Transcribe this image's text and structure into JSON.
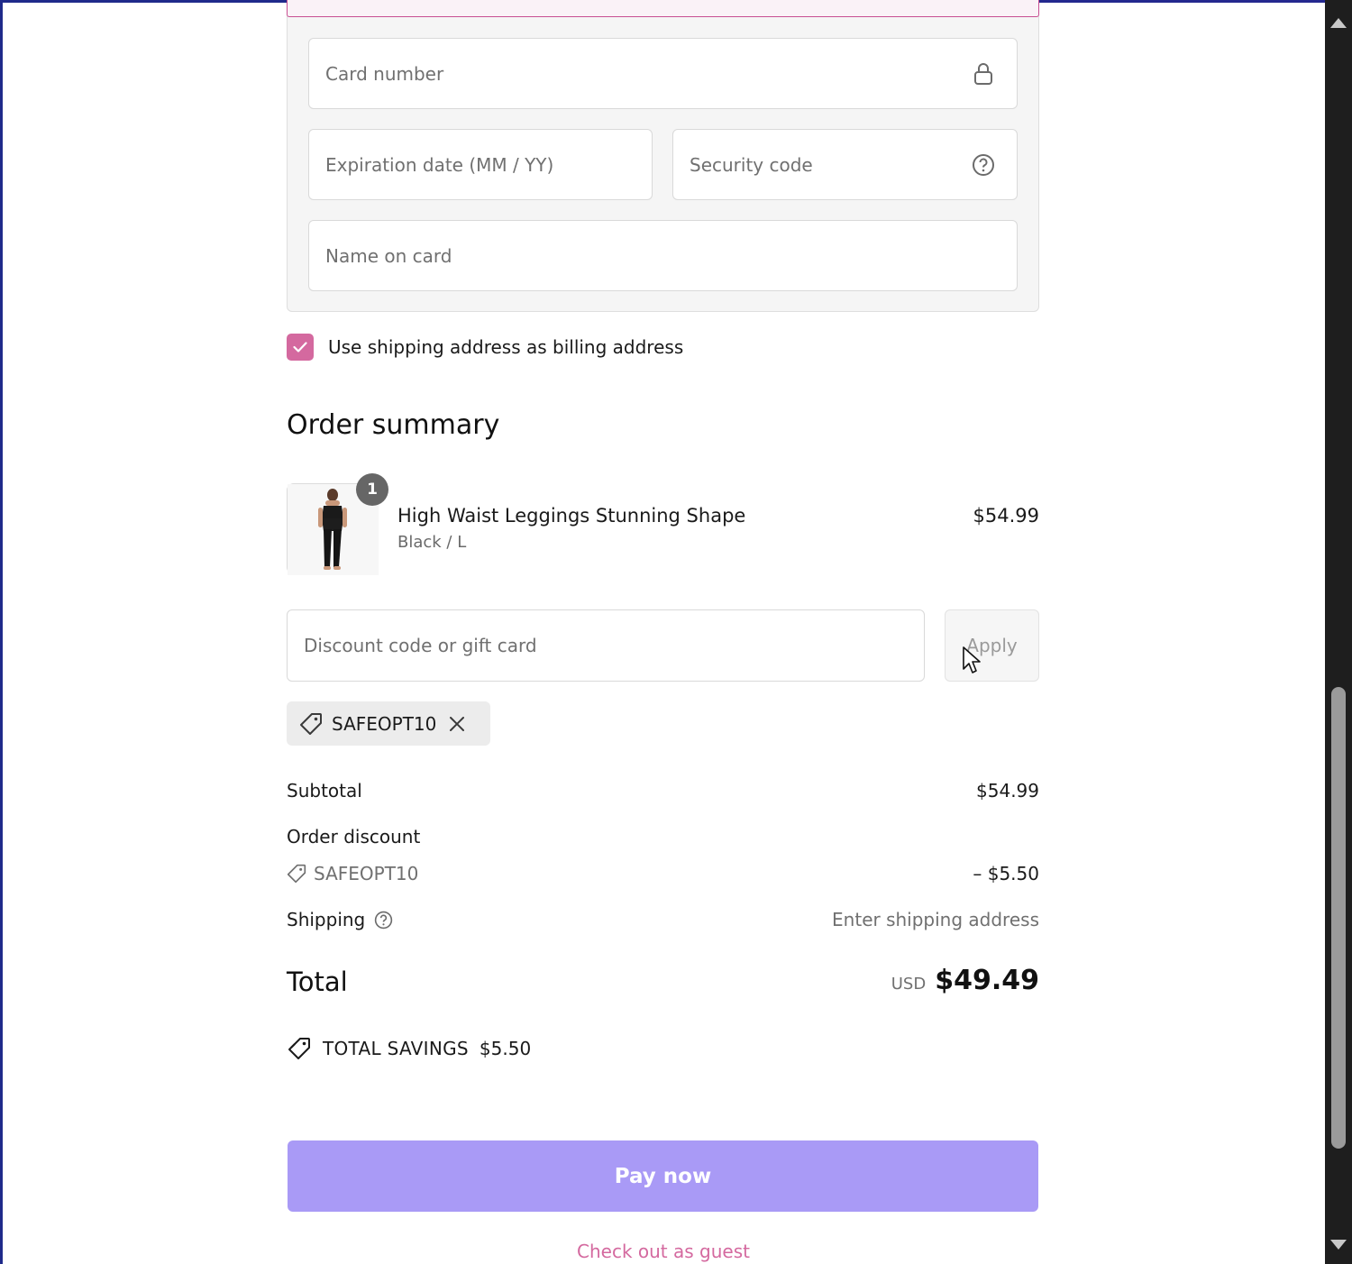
{
  "payment": {
    "card_number_placeholder": "Card number",
    "expiration_placeholder": "Expiration date (MM / YY)",
    "security_code_placeholder": "Security code",
    "name_on_card_placeholder": "Name on card",
    "use_shipping_label": "Use shipping address as billing address",
    "use_shipping_checked": true
  },
  "summary": {
    "title": "Order summary",
    "item": {
      "quantity": "1",
      "name": "High Waist Leggings Stunning Shape",
      "variant": "Black / L",
      "price": "$54.99"
    },
    "discount_placeholder": "Discount code or gift card",
    "apply_label": "Apply",
    "applied_code": "SAFEOPT10",
    "subtotal_label": "Subtotal",
    "subtotal_value": "$54.99",
    "order_discount_label": "Order discount",
    "order_discount_code": "SAFEOPT10",
    "order_discount_value": "– $5.50",
    "shipping_label": "Shipping",
    "shipping_value": "Enter shipping address",
    "total_label": "Total",
    "total_currency": "USD",
    "total_value": "$49.49",
    "savings_label": "TOTAL SAVINGS",
    "savings_value": "$5.50"
  },
  "actions": {
    "pay_label": "Pay now",
    "guest_label": "Check out as guest"
  },
  "colors": {
    "accent_pink": "#d4699f",
    "pay_button": "#a99af6"
  }
}
